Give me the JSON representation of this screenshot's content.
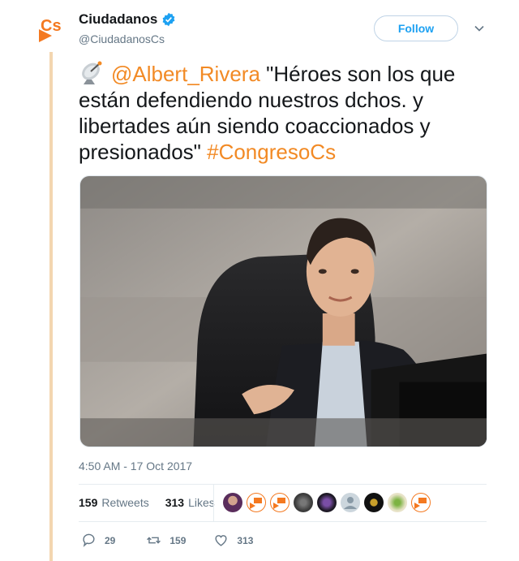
{
  "account": {
    "name": "Ciudadanos",
    "handle": "@CiudadanosCs",
    "logo_text": "Cs",
    "brand_color": "#f47920"
  },
  "follow_label": "Follow",
  "tweet": {
    "mention": "@Albert_Rivera",
    "body": " \"Héroes son los que están defendiendo nuestros dchos. y libertades aún siendo coaccionados y presionados\" ",
    "hashtag": "#CongresoCs",
    "emoji_icon": "satellite-antenna-icon"
  },
  "timestamp": "4:50 AM - 17 Oct 2017",
  "stats": {
    "retweets_count": "159",
    "retweets_label": "Retweets",
    "likes_count": "313",
    "likes_label": "Likes"
  },
  "actions": {
    "replies": "29",
    "retweets": "159",
    "likes": "313"
  },
  "colors": {
    "link": "#f28a25",
    "follow_blue": "#1da1f2",
    "muted": "#657786",
    "thread_line": "#f3d6b0"
  }
}
